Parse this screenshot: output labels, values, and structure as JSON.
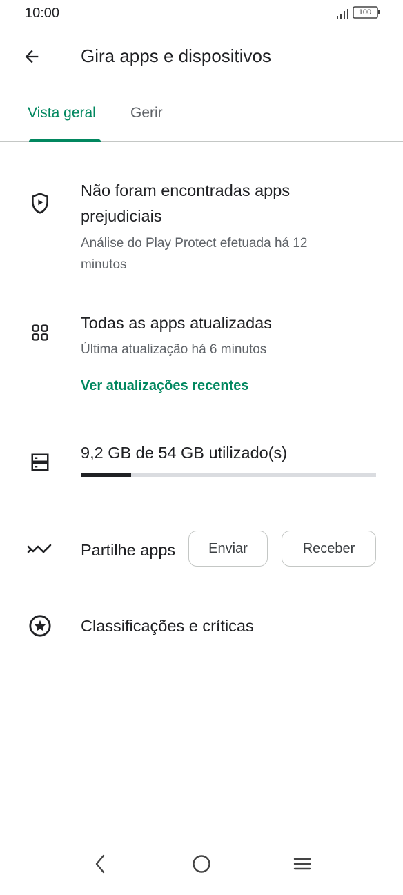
{
  "status_bar": {
    "time": "10:00",
    "battery": "100",
    "signal_icon": "signal-icon",
    "battery_icon": "battery-icon"
  },
  "header": {
    "title": "Gira apps e dispositivos",
    "back_icon": "arrow-left-icon"
  },
  "tabs": [
    {
      "label": "Vista geral",
      "active": true
    },
    {
      "label": "Gerir",
      "active": false
    }
  ],
  "protect": {
    "icon": "shield-play-icon",
    "title": "Não foram encontradas apps prejudiciais",
    "subtitle": "Análise do Play Protect efetuada há 12 minutos"
  },
  "updates": {
    "icon": "apps-grid-icon",
    "title": "Todas as apps atualizadas",
    "subtitle": "Última atualização há 6 minutos",
    "link": "Ver atualizações recentes"
  },
  "storage": {
    "icon": "storage-icon",
    "label": "9,2 GB de 54 GB utilizado(s)",
    "used_fraction": 0.17
  },
  "share": {
    "icon": "nearby-share-icon",
    "label": "Partilhe apps",
    "send_label": "Enviar",
    "receive_label": "Receber"
  },
  "ratings": {
    "icon": "star-circle-icon",
    "label": "Classificações e críticas"
  },
  "nav_bar": {
    "back_icon": "nav-back-icon",
    "home_icon": "nav-home-icon",
    "menu_icon": "nav-menu-icon"
  },
  "colors": {
    "accent": "#01875f",
    "text_primary": "#202124",
    "text_secondary": "#5f6368",
    "divider": "#c4c7c5"
  }
}
